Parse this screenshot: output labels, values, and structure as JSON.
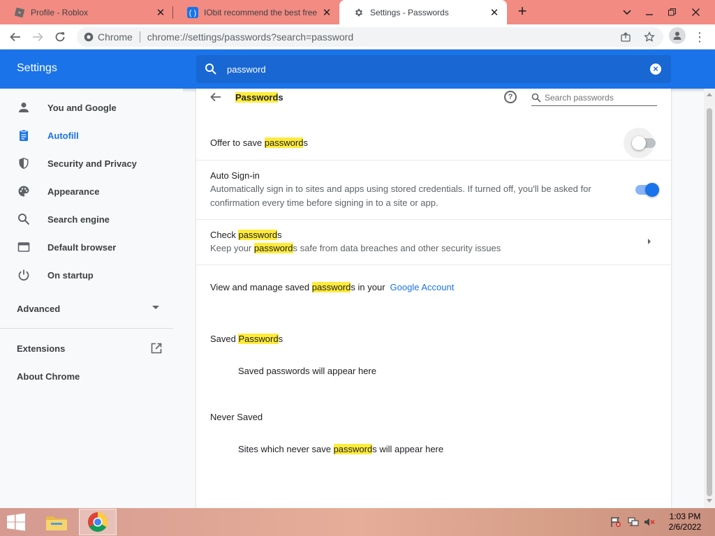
{
  "browser": {
    "tabs": [
      {
        "title": "Profile - Roblox",
        "active": false
      },
      {
        "title": "IObit recommend the best free, f",
        "active": false
      },
      {
        "title": "Settings - Passwords",
        "active": true
      }
    ],
    "omnibox": {
      "site_label": "Chrome",
      "url": "chrome://settings/passwords?search=password"
    }
  },
  "settings": {
    "header_title": "Settings",
    "search_query": "password",
    "sidebar": {
      "items": [
        {
          "label": "You and Google",
          "icon": "person-icon"
        },
        {
          "label": "Autofill",
          "icon": "clipboard-icon",
          "active": true
        },
        {
          "label": "Security and Privacy",
          "icon": "shield-icon"
        },
        {
          "label": "Appearance",
          "icon": "palette-icon"
        },
        {
          "label": "Search engine",
          "icon": "search-icon"
        },
        {
          "label": "Default browser",
          "icon": "browser-icon"
        },
        {
          "label": "On startup",
          "icon": "power-icon"
        }
      ],
      "advanced": "Advanced",
      "extensions": "Extensions",
      "about": "About Chrome"
    },
    "passwords": {
      "title_hl": "Password",
      "title_rest": "s",
      "search_placeholder": "Search passwords",
      "offer_pre": "Offer to save ",
      "offer_hl": "password",
      "offer_post": "s",
      "offer_enabled": false,
      "autosignin_title": "Auto Sign-in",
      "autosignin_desc_1": "Automatically sign in to sites and apps using stored credentials. If turned off, you'll be asked for",
      "autosignin_desc_2": "confirmation every time before signing in to a site or app.",
      "autosignin_enabled": true,
      "check_pre": "Check ",
      "check_hl": "password",
      "check_post": "s",
      "check_desc_pre": "Keep your ",
      "check_desc_hl": "password",
      "check_desc_post": "s safe from data breaches and other security issues",
      "manage_pre": "View and manage saved ",
      "manage_hl": "password",
      "manage_post": "s in your",
      "manage_link": "Google Account",
      "saved_pre": "Saved ",
      "saved_hl": "Password",
      "saved_post": "s",
      "saved_empty": "Saved passwords will appear here",
      "never_title": "Never Saved",
      "never_pre": "Sites which never save ",
      "never_hl": "password",
      "never_post": "s will appear here"
    }
  },
  "taskbar": {
    "time": "1:03 PM",
    "date": "2/6/2022"
  },
  "colors": {
    "accent": "#1a73e8",
    "highlight": "#ffeb3b",
    "tabstrip": "#f28b82"
  }
}
